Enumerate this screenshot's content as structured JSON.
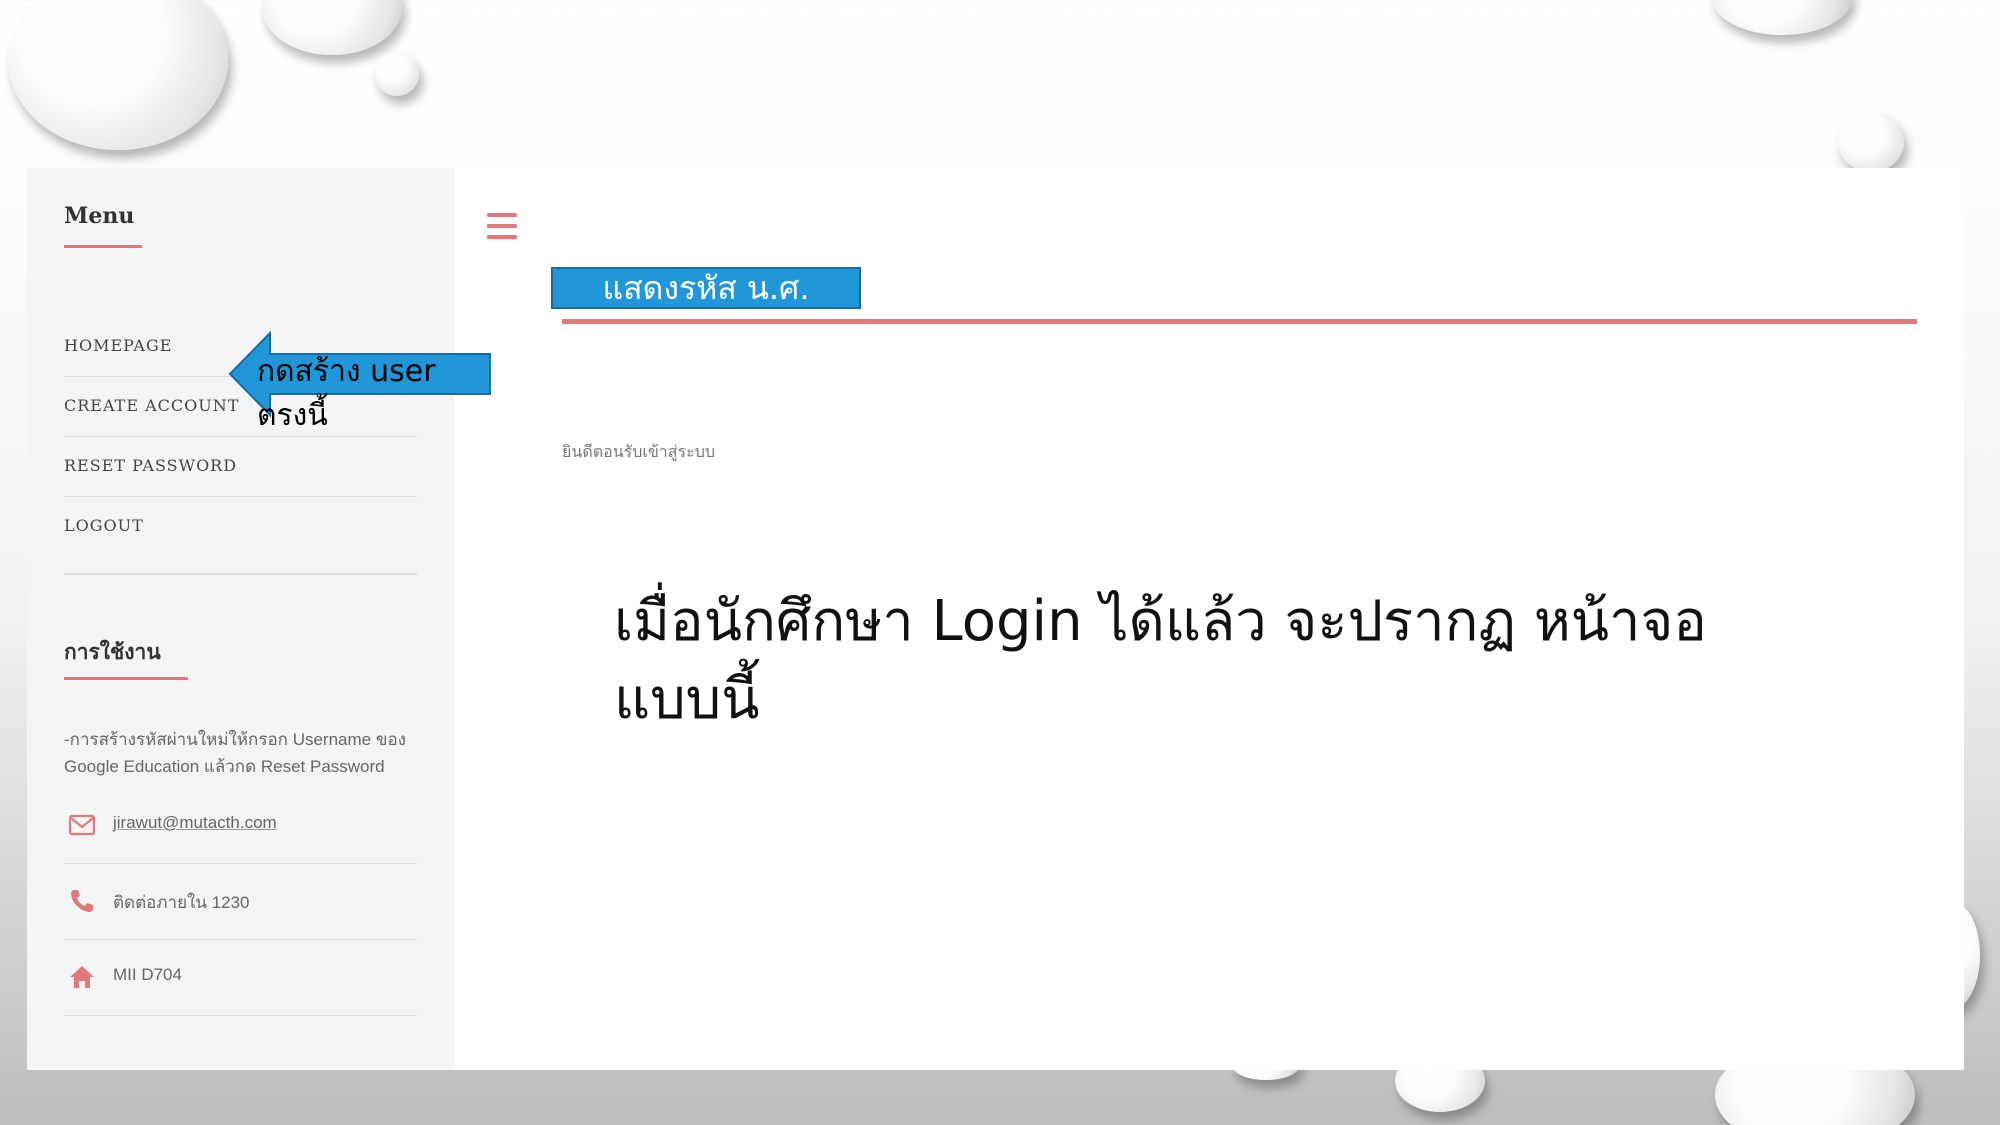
{
  "sidebar": {
    "menu_title": "Menu",
    "menu_items": [
      {
        "label": "HOMEPAGE"
      },
      {
        "label": "CREATE ACCOUNT"
      },
      {
        "label": "RESET PASSWORD"
      },
      {
        "label": "LOGOUT"
      }
    ],
    "usage_title": "การใช้งาน",
    "usage_text": "-การสร้างรหัสผ่านใหม่ให้กรอก Username ของ Google Education แล้วกด Reset Password",
    "contacts": [
      {
        "icon": "envelope-icon",
        "label": "jirawut@mutacth.com"
      },
      {
        "icon": "phone-icon",
        "label": "ติดต่อภายใน 1230"
      },
      {
        "icon": "home-icon",
        "label": "MII D704"
      }
    ]
  },
  "main": {
    "student_id_button": "แสดงรหัส น.ศ.",
    "welcome_text": "ยินดีตอนรับเข้าสู่ระบบ"
  },
  "annotations": {
    "arrow_label": "กดสร้าง user ตรงนี้",
    "callout": "เมื่อนักศึกษา Login ได้แล้ว จะปรากฏ หน้าจอแบบนี้"
  },
  "colors": {
    "accent": "#e07a7a",
    "button_blue": "#2196d8",
    "sidebar_bg": "#f3f4f6"
  }
}
